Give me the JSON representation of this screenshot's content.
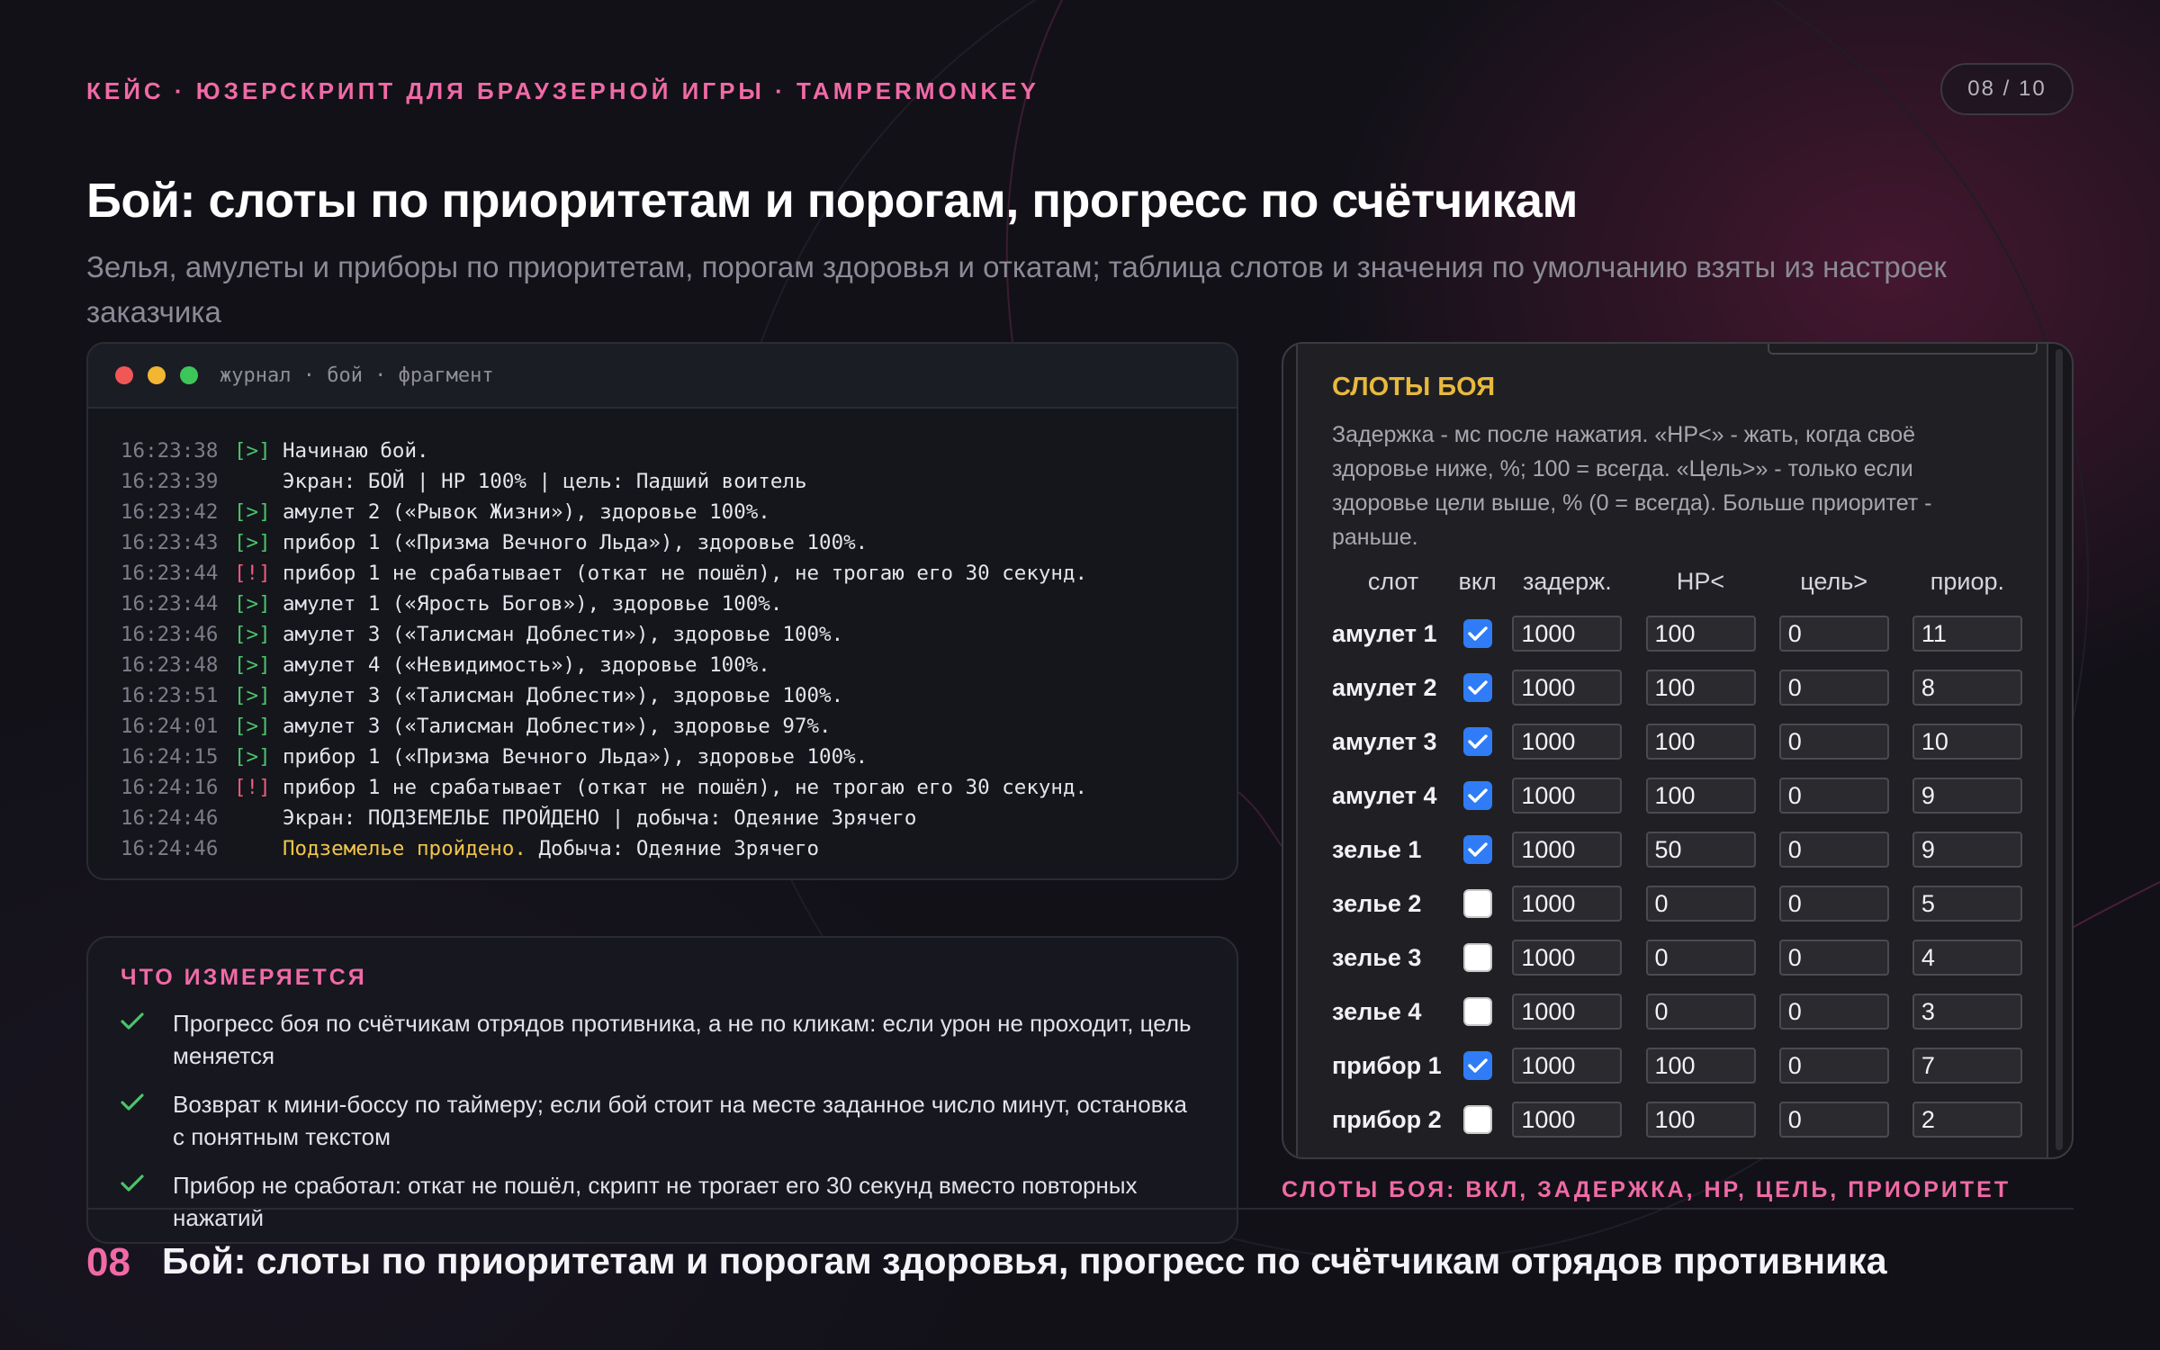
{
  "header": {
    "kicker": "КЕЙС · ЮЗЕРСКРИПТ ДЛЯ БРАУЗЕРНОЙ ИГРЫ · TAMPERMONKEY",
    "page_indicator": "08 / 10",
    "title": "Бой: слоты по приоритетам и порогам, прогресс по счётчикам",
    "subtitle": "Зелья, амулеты и приборы по приоритетам, порогам здоровья и откатам; таблица слотов и значения по умолчанию взяты из настроек заказчика"
  },
  "terminal": {
    "title": "журнал · бой · фрагмент",
    "lines": [
      {
        "time": "16:23:38",
        "tag": "[>]",
        "kind": "ok",
        "text": "Начинаю бой.",
        "highlight": ""
      },
      {
        "time": "16:23:39",
        "tag": "",
        "kind": "plain",
        "text": "Экран: БОЙ | HP 100% | цель: Падший воитель",
        "highlight": ""
      },
      {
        "time": "16:23:42",
        "tag": "[>]",
        "kind": "ok",
        "text": "амулет 2 («Рывок Жизни»), здоровье 100%.",
        "highlight": ""
      },
      {
        "time": "16:23:43",
        "tag": "[>]",
        "kind": "ok",
        "text": "прибор 1 («Призма Вечного Льда»), здоровье 100%.",
        "highlight": ""
      },
      {
        "time": "16:23:44",
        "tag": "[!]",
        "kind": "warn",
        "text": "прибор 1 не срабатывает (откат не пошёл), не трогаю его 30 секунд.",
        "highlight": ""
      },
      {
        "time": "16:23:44",
        "tag": "[>]",
        "kind": "ok",
        "text": "амулет 1 («Ярость Богов»), здоровье 100%.",
        "highlight": ""
      },
      {
        "time": "16:23:46",
        "tag": "[>]",
        "kind": "ok",
        "text": "амулет 3 («Талисман Доблести»), здоровье 100%.",
        "highlight": ""
      },
      {
        "time": "16:23:48",
        "tag": "[>]",
        "kind": "ok",
        "text": "амулет 4 («Невидимость»), здоровье 100%.",
        "highlight": ""
      },
      {
        "time": "16:23:51",
        "tag": "[>]",
        "kind": "ok",
        "text": "амулет 3 («Талисман Доблести»), здоровье 100%.",
        "highlight": ""
      },
      {
        "time": "16:24:01",
        "tag": "[>]",
        "kind": "ok",
        "text": "амулет 3 («Талисман Доблести»), здоровье 97%.",
        "highlight": ""
      },
      {
        "time": "16:24:15",
        "tag": "[>]",
        "kind": "ok",
        "text": "прибор 1 («Призма Вечного Льда»), здоровье 100%.",
        "highlight": ""
      },
      {
        "time": "16:24:16",
        "tag": "[!]",
        "kind": "warn",
        "text": "прибор 1 не срабатывает (откат не пошёл), не трогаю его 30 секунд.",
        "highlight": ""
      },
      {
        "time": "16:24:46",
        "tag": "",
        "kind": "plain",
        "text": "Экран: ПОДЗЕМЕЛЬЕ ПРОЙДЕНО | добыча: Одеяние Зрячего",
        "highlight": ""
      },
      {
        "time": "16:24:46",
        "tag": "",
        "kind": "plain",
        "text": " Добыча: Одеяние Зрячего",
        "highlight": "Подземелье пройдено."
      }
    ]
  },
  "measured": {
    "title": "ЧТО ИЗМЕРЯЕТСЯ",
    "items": [
      "Прогресс боя по счётчикам отрядов противника, а не по кликам: если урон не проходит, цель меняется",
      "Возврат к мини-боссу по таймеру; если бой стоит на месте заданное число минут, остановка с понятным текстом",
      "Прибор не сработал: откат не пошёл, скрипт не трогает его 30 секунд вместо повторных нажатий"
    ]
  },
  "slots": {
    "title": "СЛОТЫ БОЯ",
    "help": "Задержка - мс после нажатия. «HP<» - жать, когда своё здоровье ниже, %; 100 = всегда. «Цель>» - только если здоровье цели выше, % (0 = всегда). Больше приоритет - раньше.",
    "columns": [
      "слот",
      "вкл",
      "задерж.",
      "HP<",
      "цель>",
      "приор."
    ],
    "rows": [
      {
        "name": "амулет 1",
        "enabled": true,
        "delay": "1000",
        "hp": "100",
        "target": "0",
        "priority": "11"
      },
      {
        "name": "амулет 2",
        "enabled": true,
        "delay": "1000",
        "hp": "100",
        "target": "0",
        "priority": "8"
      },
      {
        "name": "амулет 3",
        "enabled": true,
        "delay": "1000",
        "hp": "100",
        "target": "0",
        "priority": "10"
      },
      {
        "name": "амулет 4",
        "enabled": true,
        "delay": "1000",
        "hp": "100",
        "target": "0",
        "priority": "9"
      },
      {
        "name": "зелье 1",
        "enabled": true,
        "delay": "1000",
        "hp": "50",
        "target": "0",
        "priority": "9"
      },
      {
        "name": "зелье 2",
        "enabled": false,
        "delay": "1000",
        "hp": "0",
        "target": "0",
        "priority": "5"
      },
      {
        "name": "зелье 3",
        "enabled": false,
        "delay": "1000",
        "hp": "0",
        "target": "0",
        "priority": "4"
      },
      {
        "name": "зелье 4",
        "enabled": false,
        "delay": "1000",
        "hp": "0",
        "target": "0",
        "priority": "3"
      },
      {
        "name": "прибор 1",
        "enabled": true,
        "delay": "1000",
        "hp": "100",
        "target": "0",
        "priority": "7"
      },
      {
        "name": "прибор 2",
        "enabled": false,
        "delay": "1000",
        "hp": "100",
        "target": "0",
        "priority": "2"
      }
    ],
    "caption": "СЛОТЫ БОЯ: ВКЛ, ЗАДЕРЖКА, HP, ЦЕЛЬ, ПРИОРИТЕТ"
  },
  "footer": {
    "number": "08",
    "text": "Бой: слоты по приоритетам и порогам здоровья, прогресс по счётчикам отрядов противника"
  },
  "colors": {
    "accent": "#f06aa6",
    "ok_tag": "#4cc46a",
    "warn_tag": "#ef5b7b",
    "highlight": "#f3c44b",
    "checkbox_on": "#2f7cf6",
    "slots_title": "#e9b93c"
  }
}
